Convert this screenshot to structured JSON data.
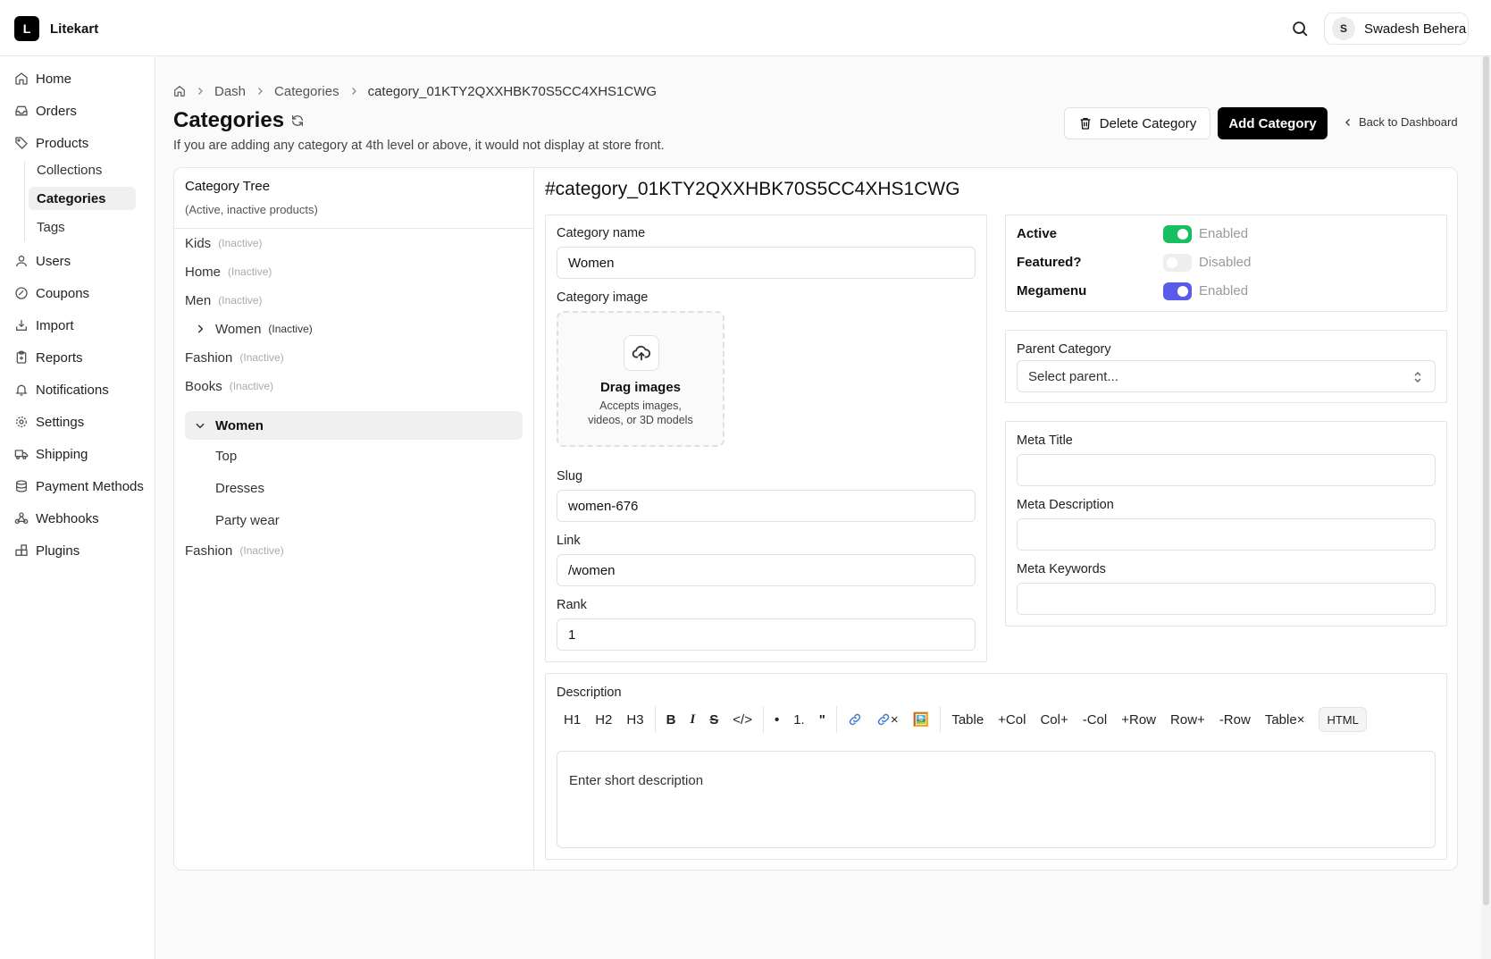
{
  "app": {
    "logo_letter": "L",
    "name": "Litekart"
  },
  "user": {
    "initial": "S",
    "name": "Swadesh Behera"
  },
  "sidebar": {
    "items": [
      {
        "label": "Home",
        "icon": "home-icon"
      },
      {
        "label": "Orders",
        "icon": "inbox-icon"
      },
      {
        "label": "Products",
        "icon": "tag-icon"
      },
      {
        "label": "Users",
        "icon": "user-icon"
      },
      {
        "label": "Coupons",
        "icon": "coupon-icon"
      },
      {
        "label": "Import",
        "icon": "import-icon"
      },
      {
        "label": "Reports",
        "icon": "clipboard-icon"
      },
      {
        "label": "Notifications",
        "icon": "bell-icon"
      },
      {
        "label": "Settings",
        "icon": "gear-icon"
      },
      {
        "label": "Shipping",
        "icon": "truck-icon"
      },
      {
        "label": "Payment Methods",
        "icon": "database-icon"
      },
      {
        "label": "Webhooks",
        "icon": "webhook-icon"
      },
      {
        "label": "Plugins",
        "icon": "blocks-icon"
      }
    ],
    "products_sub": [
      {
        "label": "Collections"
      },
      {
        "label": "Categories",
        "active": true
      },
      {
        "label": "Tags"
      }
    ]
  },
  "breadcrumb": [
    "Dash",
    "Categories",
    "category_01KTY2QXXHBK70S5CC4XHS1CWG"
  ],
  "page": {
    "title": "Categories",
    "subtitle": "If you are adding any category at 4th level or above, it would not display at store front.",
    "delete_label": "Delete Category",
    "add_label": "Add Category",
    "back_label": "Back to Dashboard"
  },
  "tree": {
    "title": "Category Tree",
    "subtitle": "(Active, inactive products)",
    "rows": [
      {
        "label": "Kids",
        "badge": "(Inactive)"
      },
      {
        "label": "Home",
        "badge": "(Inactive)"
      },
      {
        "label": "Men",
        "badge": "(Inactive)"
      },
      {
        "label": "Women",
        "badge": "(Inactive)"
      },
      {
        "label": "Fashion",
        "badge": "(Inactive)"
      },
      {
        "label": "Books",
        "badge": "(Inactive)"
      },
      {
        "label": "Women"
      },
      {
        "label": "Top"
      },
      {
        "label": "Dresses"
      },
      {
        "label": "Party wear"
      },
      {
        "label": "Fashion",
        "badge": "(Inactive)"
      }
    ]
  },
  "detail": {
    "heading": "#category_01KTY2QXXHBK70S5CC4XHS1CWG",
    "name_label": "Category name",
    "name_value": "Women",
    "image_label": "Category image",
    "drop_title": "Drag images",
    "drop_sub_1": "Accepts images,",
    "drop_sub_2": "videos, or 3D models",
    "slug_label": "Slug",
    "slug_value": "women-676",
    "link_label": "Link",
    "link_value": "/women",
    "rank_label": "Rank",
    "rank_value": "1"
  },
  "toggles": [
    {
      "label": "Active",
      "state": "Enabled",
      "on": true,
      "color": "#16c060"
    },
    {
      "label": "Featured?",
      "state": "Disabled",
      "on": false,
      "color": "#eeeeee"
    },
    {
      "label": "Megamenu",
      "state": "Enabled",
      "on": true,
      "color": "#5b5bea"
    }
  ],
  "parent": {
    "label": "Parent Category",
    "placeholder": "Select parent..."
  },
  "meta": {
    "title_label": "Meta Title",
    "description_label": "Meta Description",
    "keywords_label": "Meta Keywords"
  },
  "description": {
    "label": "Description",
    "placeholder": "Enter short description",
    "toolbar": {
      "h1": "H1",
      "h2": "H2",
      "h3": "H3",
      "bold": "B",
      "italic": "I",
      "strike": "S",
      "code": "</>",
      "bullet": "•",
      "ordered": "1.",
      "quote": "\"",
      "unlink_x": "×",
      "image": "🖼️",
      "table": "Table",
      "add_col": "+Col",
      "col_after": "Col+",
      "del_col": "-Col",
      "add_row": "+Row",
      "row_after": "Row+",
      "del_row": "-Row",
      "del_table": "Table×",
      "html": "HTML"
    }
  }
}
